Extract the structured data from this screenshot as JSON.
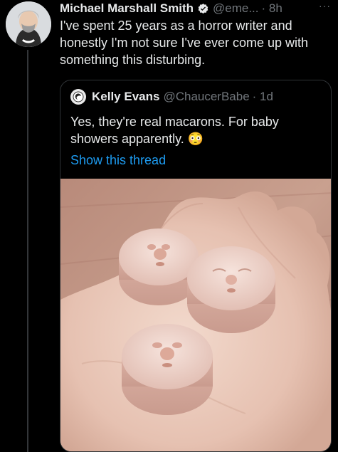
{
  "tweet": {
    "author_name": "Michael Marshall Smith",
    "author_handle": "@eme...",
    "time": "· 8h",
    "more": "···",
    "text": "I've spent 25 years as a horror writer and honestly I'm not sure I've ever come up with something this disturbing."
  },
  "quote": {
    "author_name": "Kelly Evans",
    "author_handle": "@ChaucerBabe",
    "time": "· 1d",
    "text": "Yes, they're real macarons.  For baby showers apparently. 😳",
    "show_thread": "Show this thread"
  },
  "colors": {
    "background": "#000000",
    "text": "#e7e9ea",
    "muted": "#71767b",
    "link": "#1d9bf0",
    "verified": "#1d9bf0"
  },
  "icons": [
    "verified-badge-icon",
    "more-icon"
  ]
}
